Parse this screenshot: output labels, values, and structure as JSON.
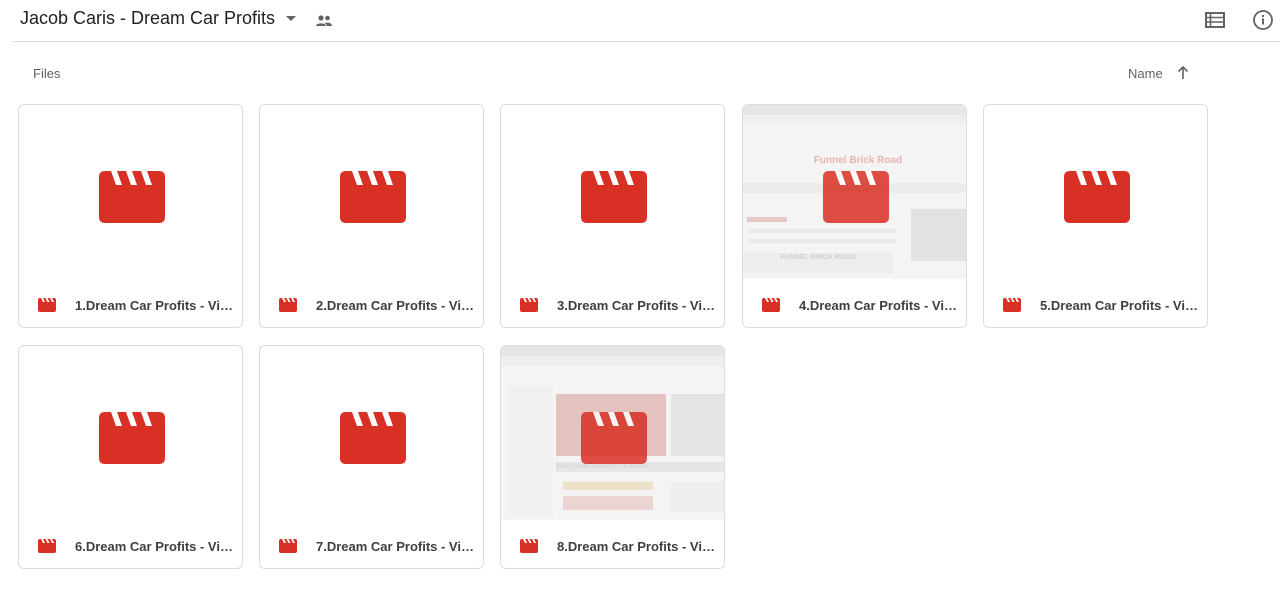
{
  "header": {
    "folder_title": "Jacob Caris - Dream Car Profits"
  },
  "toolbar": {
    "section_label": "Files",
    "sort_label": "Name"
  },
  "preview_text": {
    "card4_heading": "Funnel Brick Road",
    "card4_banner": "FUNNEL BRICK ROAD",
    "card8_caption": "Bank Private Video 1% Fill Bundle"
  },
  "files": [
    {
      "name": "1.Dream Car Profits - Vid...",
      "preview": false
    },
    {
      "name": "2.Dream Car Profits - Vid...",
      "preview": false
    },
    {
      "name": "3.Dream Car Profits - Vid...",
      "preview": false
    },
    {
      "name": "4.Dream Car Profits - Vid...",
      "preview": true
    },
    {
      "name": "5.Dream Car Profits - Vid...",
      "preview": false
    },
    {
      "name": "6.Dream Car Profits - Vid...",
      "preview": false
    },
    {
      "name": "7.Dream Car Profits - Vid...",
      "preview": false
    },
    {
      "name": "8.Dream Car Profits - Vid...",
      "preview": true
    }
  ],
  "icons": {
    "file_type": "video-clapperboard-icon",
    "shared": "people-icon",
    "list_view": "list-view-icon",
    "info": "info-icon",
    "sort": "arrow-up-icon"
  },
  "colors": {
    "video_red": "#d93025",
    "border": "#dadce0",
    "muted_text": "#5f6368"
  }
}
